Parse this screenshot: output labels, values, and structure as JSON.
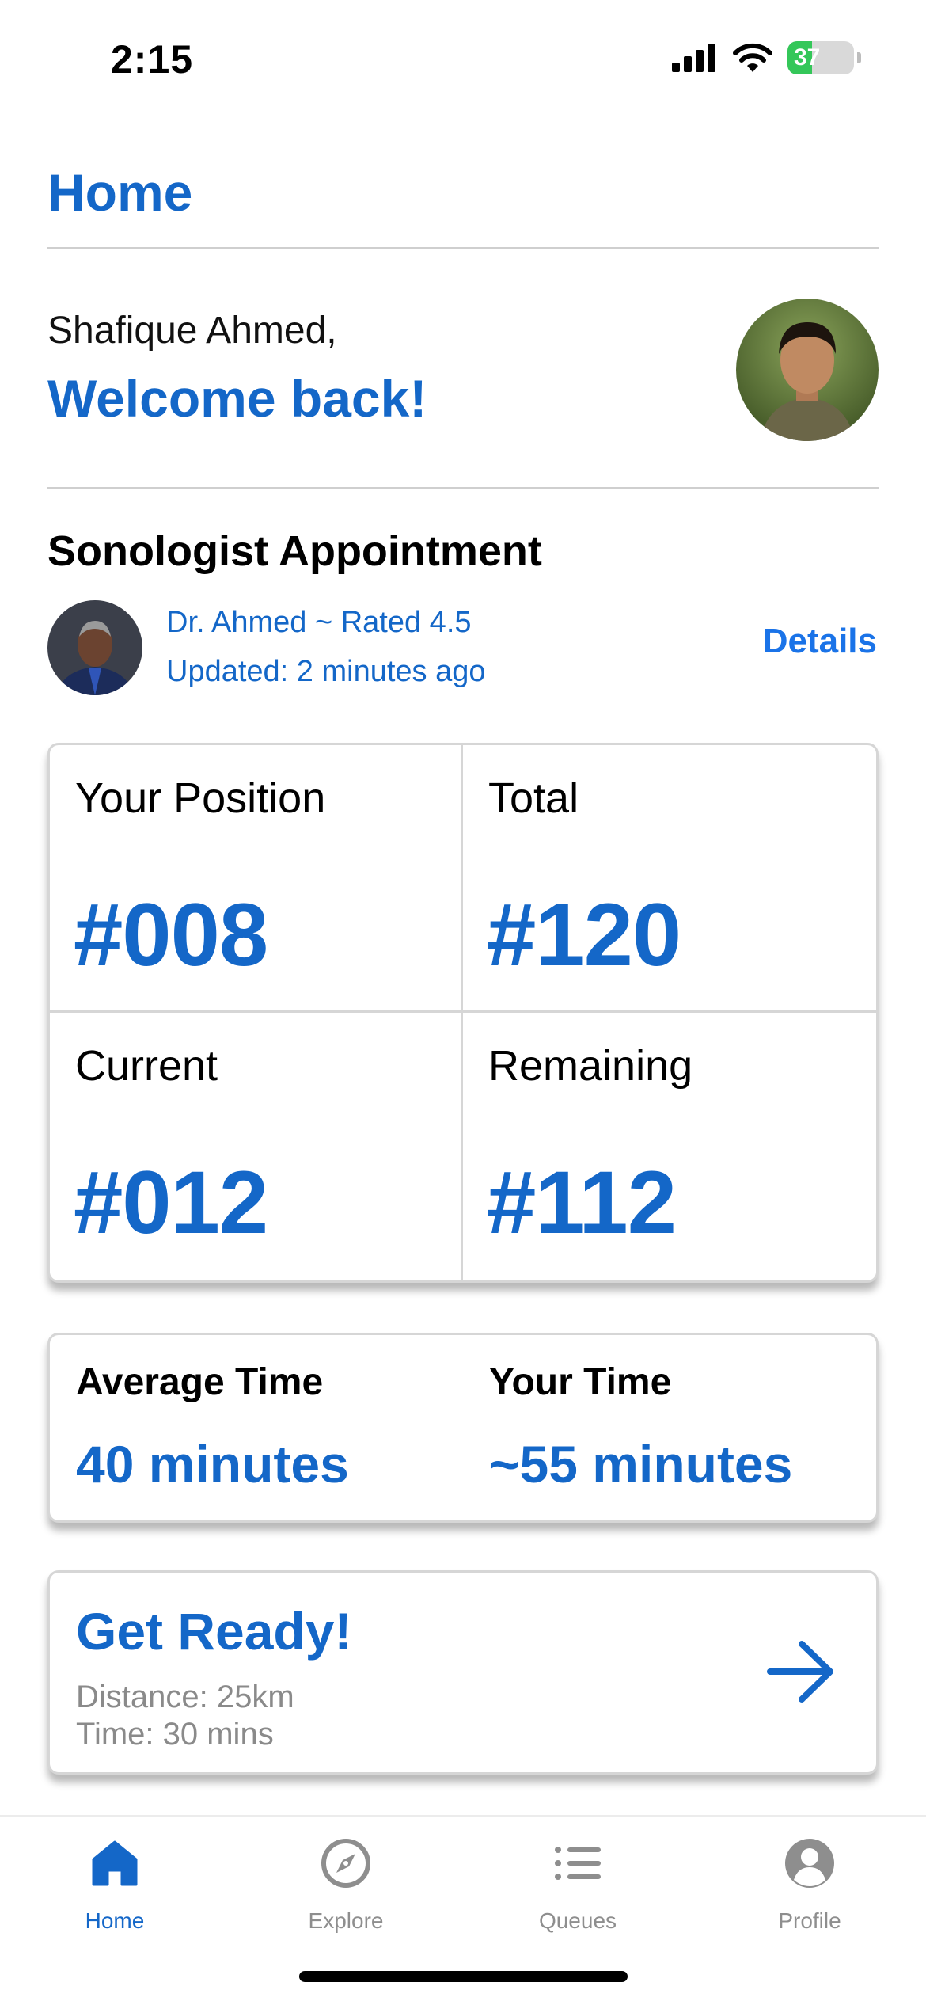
{
  "status_bar": {
    "time": "2:15",
    "battery": "37"
  },
  "header": {
    "title": "Home"
  },
  "greeting": {
    "name": "Shafique Ahmed,",
    "welcome": "Welcome back!"
  },
  "appointment": {
    "title": "Sonologist Appointment",
    "doctor_line": "Dr. Ahmed ~ Rated 4.5",
    "updated": "Updated: 2 minutes ago",
    "details_label": "Details"
  },
  "stats": [
    {
      "label": "Your Position",
      "value": "#008"
    },
    {
      "label": "Total",
      "value": "#120"
    },
    {
      "label": "Current",
      "value": "#012"
    },
    {
      "label": "Remaining",
      "value": "#112"
    }
  ],
  "times": {
    "average_label": "Average Time",
    "average_value": "40 minutes",
    "yours_label": "Your Time",
    "yours_value": "~55 minutes"
  },
  "ready": {
    "title": "Get Ready!",
    "distance": "Distance: 25km",
    "time": "Time: 30 mins",
    "icon": "arrow-right-icon"
  },
  "tabs": [
    {
      "label": "Home",
      "icon": "home-icon",
      "active": true
    },
    {
      "label": "Explore",
      "icon": "compass-icon",
      "active": false
    },
    {
      "label": "Queues",
      "icon": "list-icon",
      "active": false
    },
    {
      "label": "Profile",
      "icon": "person-circle-icon",
      "active": false
    }
  ],
  "colors": {
    "accent": "#1467c8",
    "link": "#1a73e8",
    "muted": "#8a8a8a",
    "battery": "#34c759"
  }
}
